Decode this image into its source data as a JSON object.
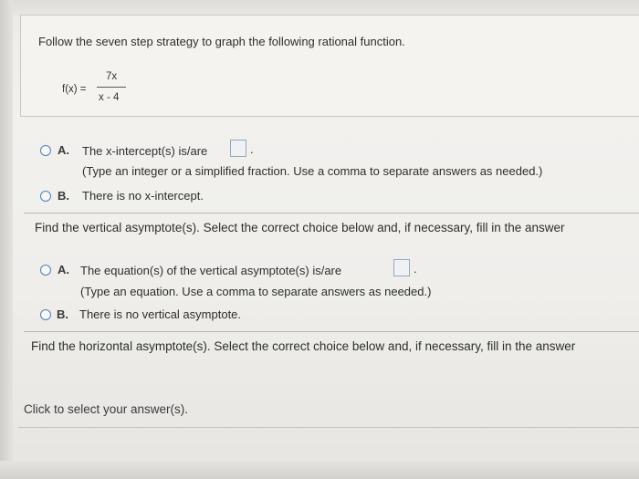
{
  "question": {
    "instruction": "Follow the seven step strategy to graph the following rational function.",
    "function_label": "f(x) =",
    "numerator": "7x",
    "denominator": "x - 4"
  },
  "x_intercept": {
    "option_a": {
      "letter": "A.",
      "text": "The x-intercept(s) is/are",
      "hint": "(Type an integer or a simplified fraction. Use a comma to separate answers as needed.)"
    },
    "option_b": {
      "letter": "B.",
      "text": "There is no x-intercept."
    }
  },
  "vertical_asymptote": {
    "prompt": "Find the vertical asymptote(s). Select the correct choice below and, if necessary, fill in the answer",
    "option_a": {
      "letter": "A.",
      "text": "The equation(s) of the vertical asymptote(s) is/are",
      "hint": "(Type an equation. Use a comma to separate answers as needed.)"
    },
    "option_b": {
      "letter": "B.",
      "text": "There is no vertical asymptote."
    }
  },
  "horizontal_asymptote": {
    "prompt": "Find the horizontal asymptote(s). Select the correct choice below and, if necessary, fill in the answer"
  },
  "footer": {
    "status": "Click to select your answer(s)."
  },
  "punctuation": {
    "period": "."
  },
  "colors": {
    "radio_border": "#4f7fb8",
    "background": "#efeeeb"
  }
}
